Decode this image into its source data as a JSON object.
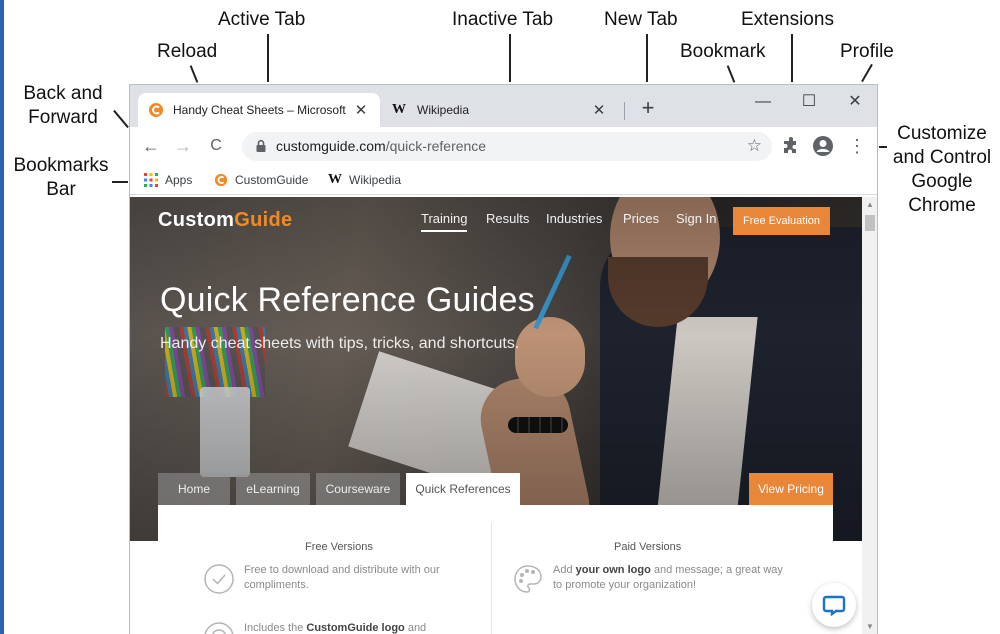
{
  "annotations": {
    "active_tab": "Active Tab",
    "inactive_tab": "Inactive Tab",
    "new_tab": "New Tab",
    "extensions": "Extensions",
    "reload": "Reload",
    "bookmark": "Bookmark",
    "profile": "Profile",
    "back_forward_1": "Back and",
    "back_forward_2": "Forward",
    "bookmarks_bar_1": "Bookmarks",
    "bookmarks_bar_2": "Bar",
    "customize_1": "Customize",
    "customize_2": "and Control",
    "customize_3": "Google",
    "customize_4": "Chrome"
  },
  "tabs": [
    {
      "title": "Handy Cheat Sheets – Microsoft",
      "close": "✕",
      "favicon": "customguide-icon"
    },
    {
      "title": "Wikipedia",
      "close": "✕",
      "favicon": "wikipedia-icon"
    }
  ],
  "new_tab_symbol": "+",
  "window_controls": {
    "minimize": "—",
    "maximize": "☐",
    "close": "✕"
  },
  "toolbar": {
    "back": "←",
    "forward": "→",
    "reload": "C",
    "url_domain": "customguide.com",
    "url_path": "/quick-reference",
    "bookmark_star": "☆",
    "menu": "⋮"
  },
  "bookmarks_bar": [
    {
      "label": "Apps",
      "icon": "apps-grid-icon"
    },
    {
      "label": "CustomGuide",
      "icon": "customguide-icon"
    },
    {
      "label": "Wikipedia",
      "icon": "wikipedia-icon"
    }
  ],
  "site": {
    "brand_prefix": "Custom",
    "brand_accent": "Guide",
    "nav": [
      "Training",
      "Results",
      "Industries",
      "Prices",
      "Sign In"
    ],
    "free_evaluation": "Free Evaluation",
    "hero_title": "Quick Reference Guides",
    "hero_subtitle": "Handy cheat sheets with tips, tricks, and shortcuts.",
    "subtabs": [
      "Home",
      "eLearning",
      "Courseware",
      "Quick References"
    ],
    "view_pricing": "View Pricing",
    "free_versions": {
      "heading": "Free Versions",
      "item1": "Free to download and distribute with our compliments.",
      "item2_pre": "Includes the ",
      "item2_bold": "CustomGuide logo",
      "item2_post": " and"
    },
    "paid_versions": {
      "heading": "Paid Versions",
      "item1_pre": "Add ",
      "item1_bold": "your own logo",
      "item1_post": " and message; a great way to promote your organization!"
    }
  },
  "colors": {
    "accent_orange": "#e8863a",
    "tabstrip": "#dee1e6",
    "omnibox": "#f1f3f4"
  }
}
